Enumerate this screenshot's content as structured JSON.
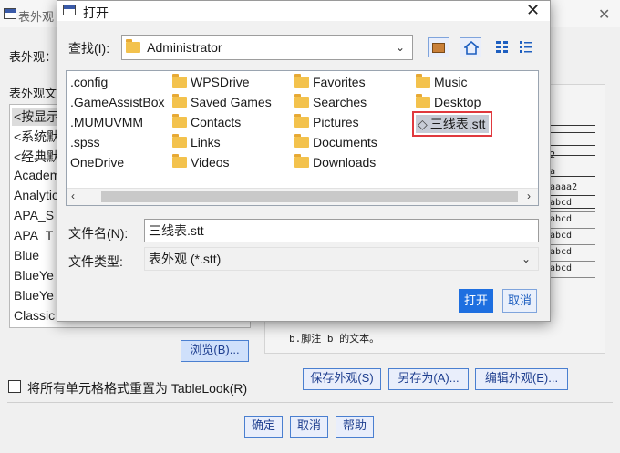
{
  "bg_window": {
    "title": "表外观",
    "close": "✕",
    "label_appearance": "表外观：",
    "label_list": "表外观文",
    "list_items": [
      "<按显示",
      "<系统默",
      "<经典默",
      "Academ",
      "Analytic",
      "APA_S",
      "APA_T",
      "Blue",
      "BlueYe",
      "BlueYe",
      "Classic"
    ],
    "browse_button": "浏览(B)...",
    "reset_checkbox": "将所有单元格格式重置为 TableLook(R)",
    "save_button": "保存外观(S)",
    "saveas_button": "另存为(A)...",
    "edit_button": "编辑外观(E)...",
    "ok_button": "确定",
    "cancel_button": "取消",
    "help_button": "帮助",
    "preview": {
      "values": [
        "2",
        "a",
        "aaaa2",
        "abcd",
        "abcd",
        "abcd",
        "abcd",
        "abcd"
      ],
      "footnote": "b.脚注 b 的文本。"
    }
  },
  "open_dialog": {
    "title": "打开",
    "close": "✕",
    "lookin_label": "查找(I):",
    "lookin_value": "Administrator",
    "columns": [
      [
        {
          "name": ".config",
          "folder": false
        },
        {
          "name": ".GameAssistBox",
          "folder": false
        },
        {
          "name": ".MUMUVMM",
          "folder": false
        },
        {
          "name": ".spss",
          "folder": false
        },
        {
          "name": "OneDrive",
          "folder": false
        }
      ],
      [
        {
          "name": "WPSDrive",
          "folder": true
        },
        {
          "name": "Saved Games",
          "folder": true
        },
        {
          "name": "Contacts",
          "folder": true
        },
        {
          "name": "Links",
          "folder": true
        },
        {
          "name": "Videos",
          "folder": true
        }
      ],
      [
        {
          "name": "Favorites",
          "folder": true
        },
        {
          "name": "Searches",
          "folder": true
        },
        {
          "name": "Pictures",
          "folder": true
        },
        {
          "name": "Documents",
          "folder": true
        },
        {
          "name": "Downloads",
          "folder": true
        }
      ],
      [
        {
          "name": "Music",
          "folder": true
        },
        {
          "name": "Desktop",
          "folder": true
        },
        {
          "name": "三线表.stt",
          "folder": false,
          "selected": true
        }
      ]
    ],
    "filename_label": "文件名(N):",
    "filename_value": "三线表.stt",
    "filetype_label": "文件类型:",
    "filetype_value": "表外观 (*.stt)",
    "open_button": "打开",
    "cancel_button": "取消",
    "colors": {
      "accent": "#1e6fe0",
      "highlight": "#e0393e"
    }
  }
}
